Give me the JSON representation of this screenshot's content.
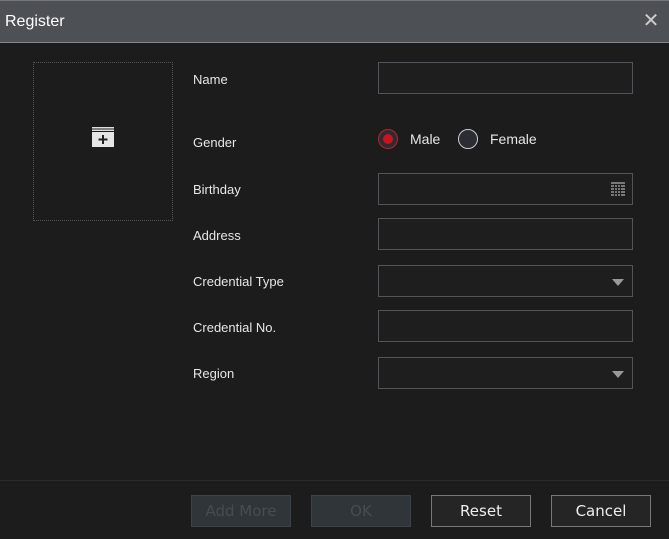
{
  "dialog": {
    "title": "Register"
  },
  "photo": {
    "icon": "add-photo-icon"
  },
  "form": {
    "name_label": "Name",
    "gender_label": "Gender",
    "male": "Male",
    "female": "Female",
    "gender_selected": "Male",
    "birthday_label": "Birthday",
    "address_label": "Address",
    "credential_type_label": "Credential Type",
    "credential_no_label": "Credential No.",
    "region_label": "Region",
    "name_value": "",
    "birthday_value": "",
    "address_value": "",
    "credential_type_value": "",
    "credential_no_value": "",
    "region_value": ""
  },
  "buttons": {
    "add_more": "Add More",
    "ok": "OK",
    "reset": "Reset",
    "cancel": "Cancel"
  },
  "colors": {
    "accent": "#c8141e",
    "titlebar": "#4d5055",
    "background": "#1c1c1c"
  }
}
